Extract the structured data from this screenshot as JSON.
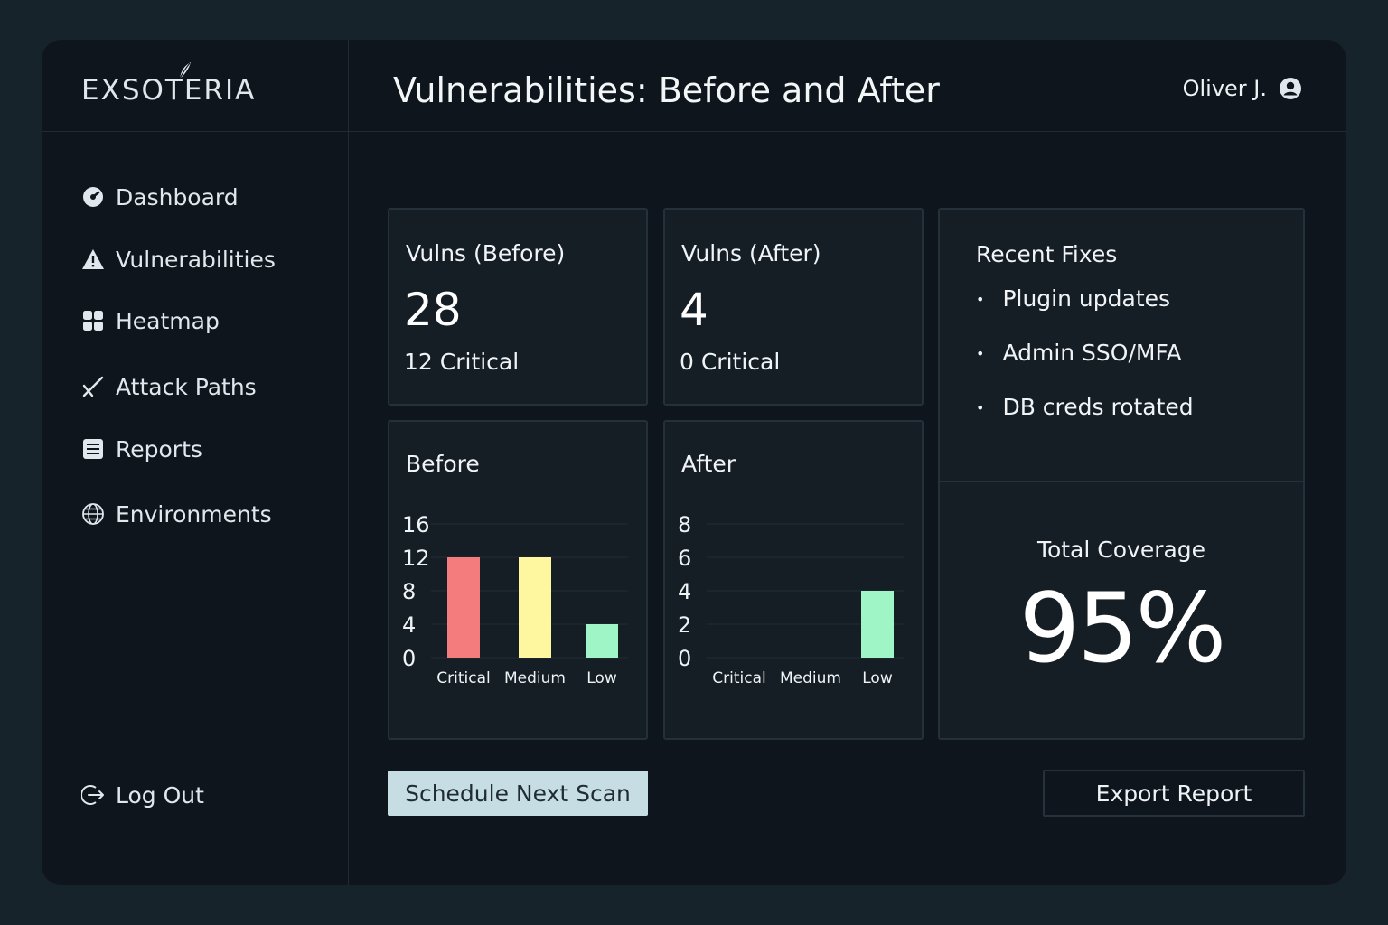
{
  "app": {
    "logo": "EXSOTERIA"
  },
  "header": {
    "title": "Vulnerabilities: Before and After",
    "user_name": "Oliver J."
  },
  "sidebar": {
    "items": [
      {
        "label": "Dashboard",
        "icon": "dashboard-icon"
      },
      {
        "label": "Vulnerabilities",
        "icon": "warning-icon"
      },
      {
        "label": "Heatmap",
        "icon": "grid-icon"
      },
      {
        "label": "Attack Paths",
        "icon": "attack-path-icon"
      },
      {
        "label": "Reports",
        "icon": "report-icon"
      },
      {
        "label": "Environments",
        "icon": "globe-icon"
      }
    ],
    "logout": "Log Out"
  },
  "stats": {
    "before": {
      "label": "Vulns (Before)",
      "count": "28",
      "sub": "12 Critical"
    },
    "after": {
      "label": "Vulns (After)",
      "count": "4",
      "sub": "0 Critical"
    }
  },
  "fixes": {
    "title": "Recent Fixes",
    "items": [
      "Plugin updates",
      "Admin SSO/MFA",
      "DB creds rotated"
    ]
  },
  "coverage": {
    "label": "Total Coverage",
    "value": "95%"
  },
  "chart_data": [
    {
      "type": "bar",
      "title": "Before",
      "categories": [
        "Critical",
        "Medium",
        "Low"
      ],
      "values": [
        12,
        12,
        4
      ],
      "ylim": [
        0,
        16
      ],
      "yticks": [
        "0",
        "4",
        "8",
        "12",
        "16"
      ],
      "colors": [
        "#f47c7c",
        "#fff6a0",
        "#9ff5c6"
      ],
      "grid": true
    },
    {
      "type": "bar",
      "title": "After",
      "categories": [
        "Critical",
        "Medium",
        "Low"
      ],
      "values": [
        0,
        0,
        4
      ],
      "ylim": [
        0,
        8
      ],
      "yticks": [
        "0",
        "2",
        "4",
        "6",
        "8"
      ],
      "colors": [
        "#f47c7c",
        "#fff6a0",
        "#9ff5c6"
      ],
      "grid": true
    }
  ],
  "actions": {
    "schedule": "Schedule Next Scan",
    "export": "Export Report"
  }
}
